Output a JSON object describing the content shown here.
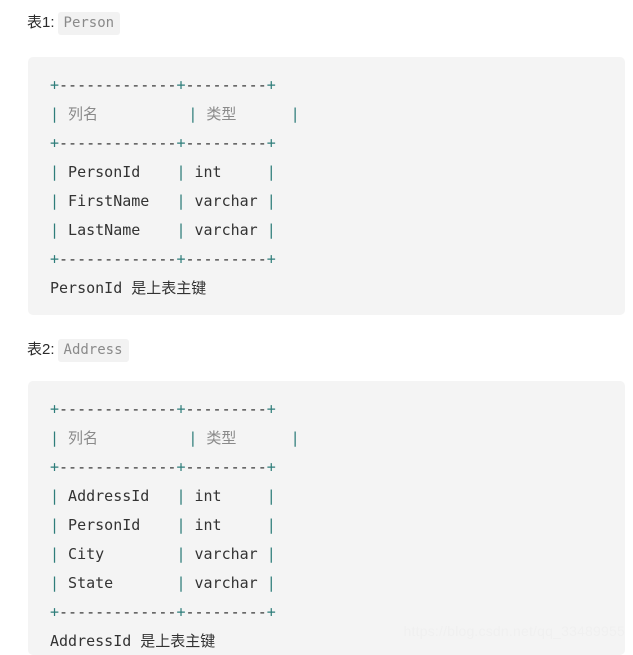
{
  "document": {
    "sections": [
      {
        "heading_label": "表1:",
        "heading_code": "Person",
        "code_lines": [
          "+-------------+---------+",
          "| 列名          | 类型      |",
          "+-------------+---------+",
          "| PersonId    | int     |",
          "| FirstName   | varchar |",
          "| LastName    | varchar |",
          "+-------------+---------+",
          "PersonId 是上表主键"
        ],
        "table": {
          "columns": [
            "列名",
            "类型"
          ],
          "rows": [
            [
              "PersonId",
              "int"
            ],
            [
              "FirstName",
              "varchar"
            ],
            [
              "LastName",
              "varchar"
            ]
          ],
          "note": "PersonId 是上表主键",
          "primary_key": "PersonId"
        }
      },
      {
        "heading_label": "表2:",
        "heading_code": "Address",
        "code_lines": [
          "+-------------+---------+",
          "| 列名          | 类型      |",
          "+-------------+---------+",
          "| AddressId   | int     |",
          "| PersonId    | int     |",
          "| City        | varchar |",
          "| State       | varchar |",
          "+-------------+---------+",
          "AddressId 是上表主键"
        ],
        "table": {
          "columns": [
            "列名",
            "类型"
          ],
          "rows": [
            [
              "AddressId",
              "int"
            ],
            [
              "PersonId",
              "int"
            ],
            [
              "City",
              "varchar"
            ],
            [
              "State",
              "varchar"
            ]
          ],
          "note": "AddressId 是上表主键",
          "primary_key": "AddressId"
        }
      }
    ],
    "watermark": "https://blog.csdn.net/qq_33489955",
    "colors": {
      "page_background": "#ffffff",
      "code_block_background": "#f4f4f4",
      "code_chip_background": "#f2f2f2",
      "code_text": "#333333",
      "cjk_text": "#8a8a8a",
      "pipe_accent": "#2e7d7a",
      "watermark_text": "#f0f0f0"
    }
  }
}
